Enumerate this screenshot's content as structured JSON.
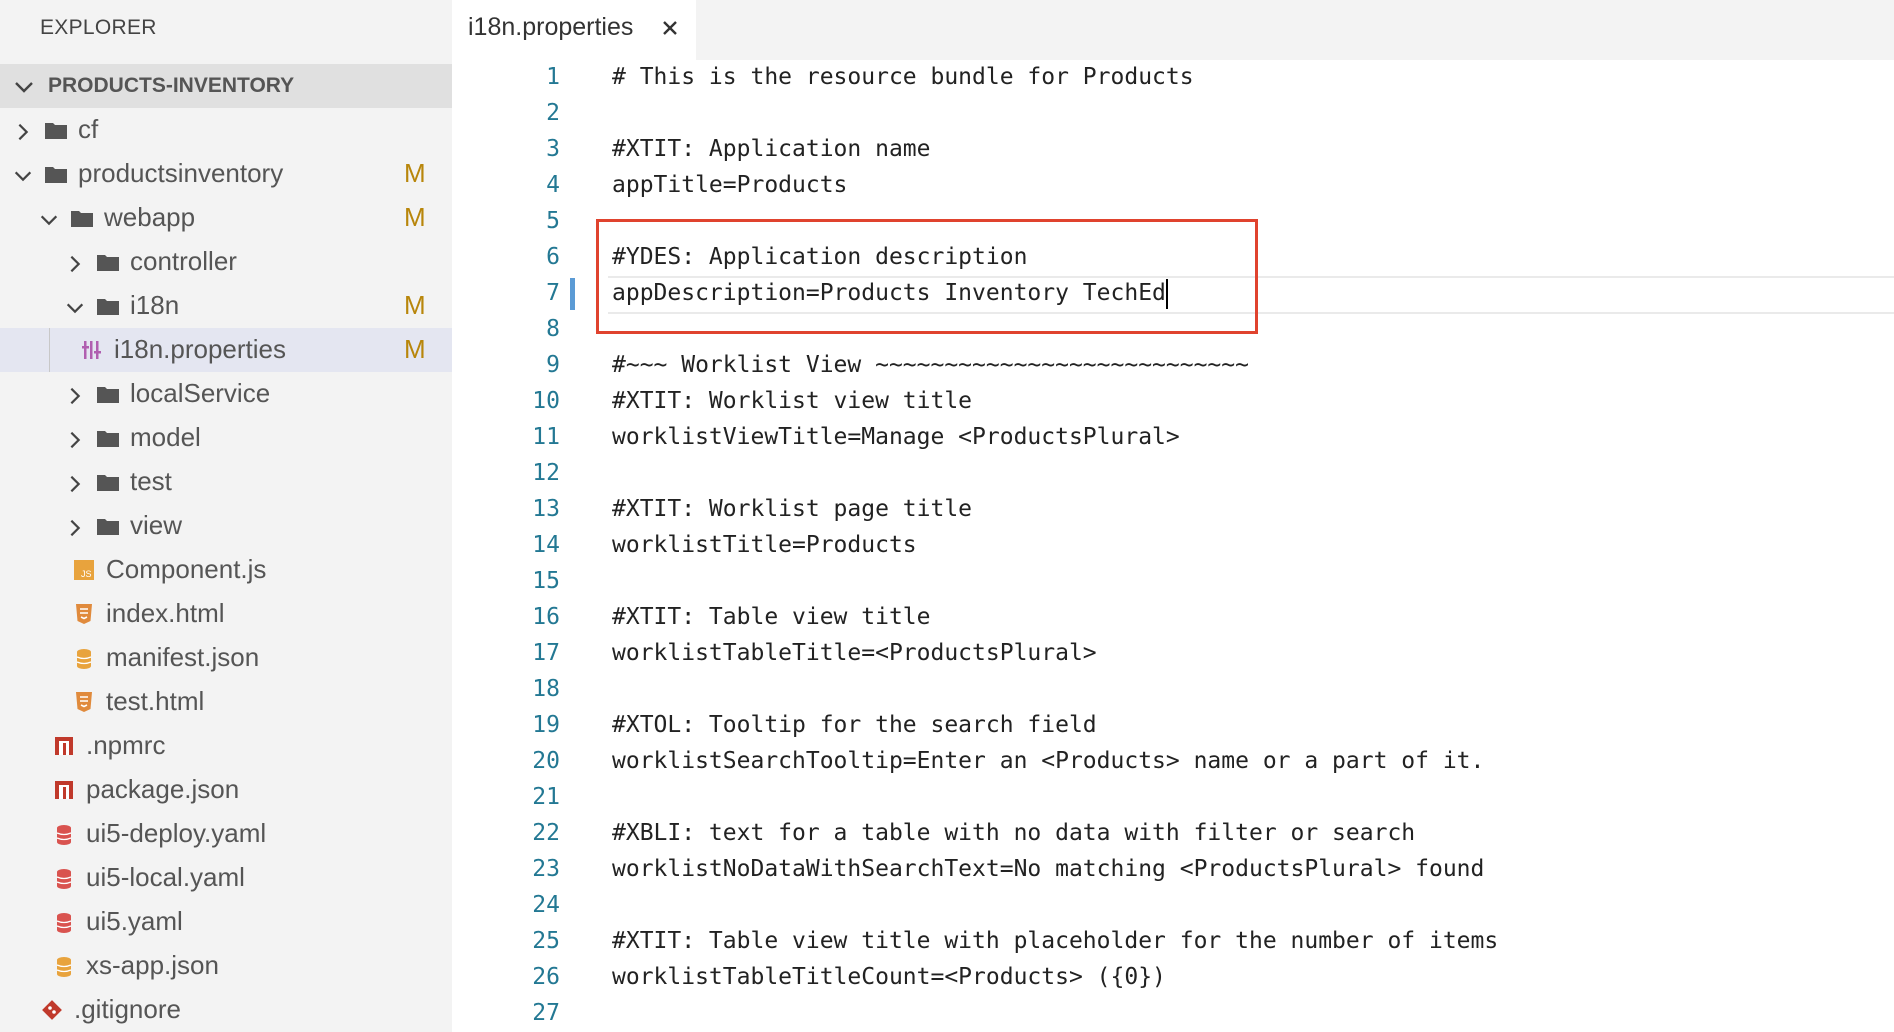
{
  "sidebar": {
    "title": "EXPLORER",
    "project": "PRODUCTS-INVENTORY",
    "items": [
      {
        "label": "cf",
        "type": "folder",
        "expanded": false,
        "badge": ""
      },
      {
        "label": "productsinventory",
        "type": "folder",
        "expanded": true,
        "badge": "M"
      },
      {
        "label": "webapp",
        "type": "folder",
        "expanded": true,
        "badge": "M"
      },
      {
        "label": "controller",
        "type": "folder",
        "expanded": false,
        "badge": ""
      },
      {
        "label": "i18n",
        "type": "folder",
        "expanded": true,
        "badge": "M"
      },
      {
        "label": "i18n.properties",
        "type": "properties-file",
        "badge": "M",
        "selected": true
      },
      {
        "label": "localService",
        "type": "folder",
        "expanded": false,
        "badge": ""
      },
      {
        "label": "model",
        "type": "folder",
        "expanded": false,
        "badge": ""
      },
      {
        "label": "test",
        "type": "folder",
        "expanded": false,
        "badge": ""
      },
      {
        "label": "view",
        "type": "folder",
        "expanded": false,
        "badge": ""
      },
      {
        "label": "Component.js",
        "type": "js-file",
        "badge": ""
      },
      {
        "label": "index.html",
        "type": "html-file",
        "badge": ""
      },
      {
        "label": "manifest.json",
        "type": "json-file",
        "badge": ""
      },
      {
        "label": "test.html",
        "type": "html-file",
        "badge": ""
      },
      {
        "label": ".npmrc",
        "type": "npm-file",
        "badge": ""
      },
      {
        "label": "package.json",
        "type": "npm-file",
        "badge": ""
      },
      {
        "label": "ui5-deploy.yaml",
        "type": "yaml-file",
        "badge": ""
      },
      {
        "label": "ui5-local.yaml",
        "type": "yaml-file",
        "badge": ""
      },
      {
        "label": "ui5.yaml",
        "type": "yaml-file",
        "badge": ""
      },
      {
        "label": "xs-app.json",
        "type": "json-file",
        "badge": ""
      },
      {
        "label": ".gitignore",
        "type": "git-file",
        "badge": ""
      }
    ]
  },
  "tab": {
    "label": "i18n.properties",
    "close_icon": "close-icon"
  },
  "editor": {
    "current_line": 7,
    "lines": [
      "# This is the resource bundle for Products",
      "",
      "#XTIT: Application name",
      "appTitle=Products",
      "",
      "#YDES: Application description",
      "appDescription=Products Inventory TechEd",
      "",
      "#~~~ Worklist View ~~~~~~~~~~~~~~~~~~~~~~~~~~~",
      "#XTIT: Worklist view title",
      "worklistViewTitle=Manage <ProductsPlural>",
      "",
      "#XTIT: Worklist page title",
      "worklistTitle=Products",
      "",
      "#XTIT: Table view title",
      "worklistTableTitle=<ProductsPlural>",
      "",
      "#XTOL: Tooltip for the search field",
      "worklistSearchTooltip=Enter an <Products> name or a part of it.",
      "",
      "#XBLI: text for a table with no data with filter or search",
      "worklistNoDataWithSearchText=No matching <ProductsPlural> found",
      "",
      "#XTIT: Table view title with placeholder for the number of items",
      "worklistTableTitleCount=<Products> ({0})",
      ""
    ]
  },
  "colors": {
    "sidebar_bg": "#f3f3f3",
    "selected_bg": "#e4e6f1",
    "badge": "#b8860b",
    "line_number": "#237893",
    "highlight_box": "#e0432e"
  }
}
